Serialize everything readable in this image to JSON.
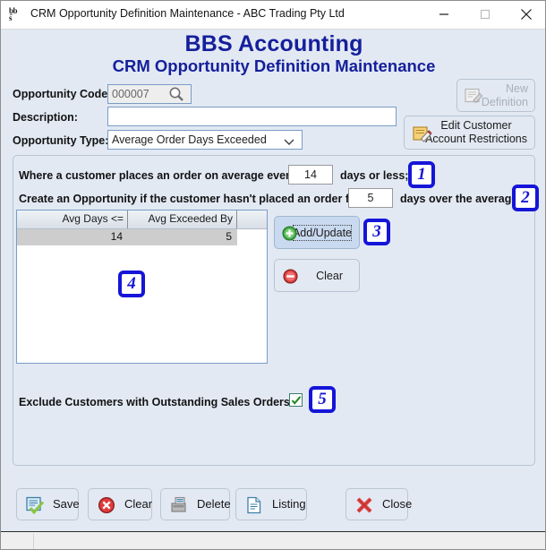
{
  "window": {
    "title": "CRM Opportunity Definition Maintenance - ABC Trading Pty Ltd",
    "icon": "bbs-app-icon",
    "minimize_label": "Minimize",
    "maximize_label": "Maximize",
    "close_label": "Close"
  },
  "header": {
    "line1": "BBS Accounting",
    "line2": "CRM Opportunity Definition Maintenance",
    "color": "#151f9b"
  },
  "form": {
    "opportunity_code_label": "Opportunity Code:",
    "opportunity_code_value": "000007",
    "opportunity_code_search_icon": "magnifier-icon",
    "description_label": "Description:",
    "description_value": "",
    "description_placeholder": "",
    "opportunity_type_label": "Opportunity Type:",
    "opportunity_type_value": "Average Order Days Exceeded",
    "opportunity_type_options": [
      "Average Order Days Exceeded"
    ]
  },
  "side_buttons": {
    "new_definition": "New\nDefinition",
    "new_definition_line1": "New",
    "new_definition_line2": "Definition",
    "new_definition_disabled": true,
    "edit_customer_line1": "Edit Customer",
    "edit_customer_line2": "Account Restrictions"
  },
  "criteria": {
    "row1_prefix": "Where a customer places an order on average every",
    "row1_value": "14",
    "row1_suffix": "days or less;",
    "row2_prefix": "Create an Opportunity if the customer hasn't placed an order for",
    "row2_value": "5",
    "row2_suffix": "days over the average"
  },
  "grid": {
    "columns": [
      "Avg Days <=",
      "Avg Exceeded By",
      ""
    ],
    "rows": [
      {
        "avg_days": "14",
        "avg_exceeded_by": "5",
        "extra": ""
      }
    ]
  },
  "grid_buttons": {
    "add_update": "Add/Update",
    "add_update_icon": "plus-circle-icon",
    "clear": "Clear",
    "clear_icon": "minus-circle-icon"
  },
  "exclude": {
    "label": "Exclude Customers with Outstanding Sales Orders:",
    "checked": true
  },
  "badges": [
    {
      "id": "badge-1",
      "text": "1"
    },
    {
      "id": "badge-2",
      "text": "2"
    },
    {
      "id": "badge-3",
      "text": "3"
    },
    {
      "id": "badge-4",
      "text": "4"
    },
    {
      "id": "badge-5",
      "text": "5"
    }
  ],
  "toolbar": {
    "save": "Save",
    "save_icon": "save-checkmark-icon",
    "clear": "Clear",
    "clear_icon": "red-x-octagon-icon",
    "delete": "Delete",
    "delete_icon": "shredder-icon",
    "listing": "Listing",
    "listing_icon": "document-icon",
    "close": "Close",
    "close_icon": "red-cross-icon"
  },
  "status": {
    "text": ""
  }
}
